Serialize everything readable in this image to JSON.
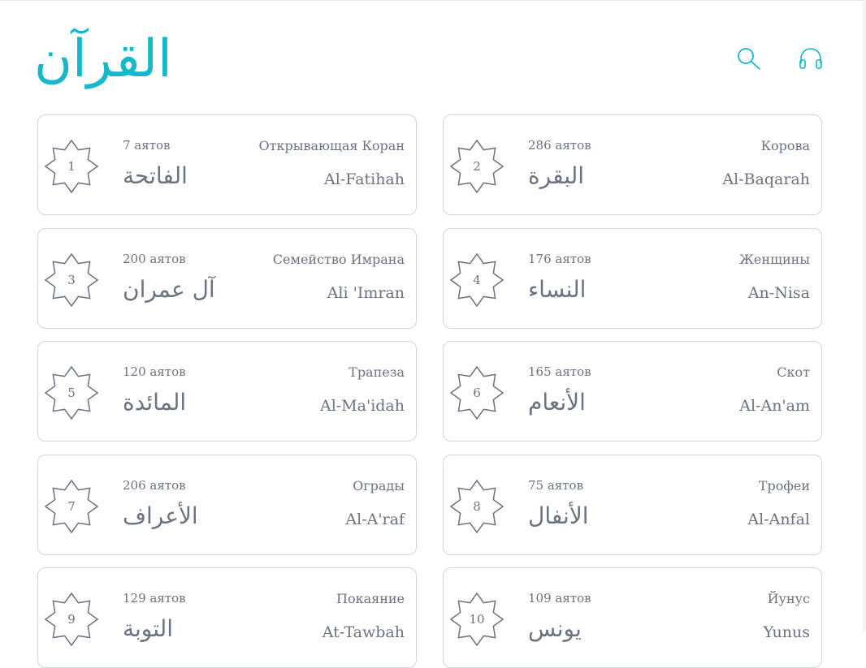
{
  "header": {
    "logo": "القرآن",
    "icons": [
      "search-icon",
      "headphones-icon"
    ],
    "accent_color": "#14b8c8"
  },
  "surahs": [
    {
      "number": "1",
      "ayahs": "7 аятов",
      "name_ru": "Открывающая Коран",
      "name_ar": "الفاتحة",
      "name_en": "Al-Fatihah"
    },
    {
      "number": "2",
      "ayahs": "286 аятов",
      "name_ru": "Корова",
      "name_ar": "البقرة",
      "name_en": "Al-Baqarah"
    },
    {
      "number": "3",
      "ayahs": "200 аятов",
      "name_ru": "Семейство Имрана",
      "name_ar": "آل عمران",
      "name_en": "Ali 'Imran"
    },
    {
      "number": "4",
      "ayahs": "176 аятов",
      "name_ru": "Женщины",
      "name_ar": "النساء",
      "name_en": "An-Nisa"
    },
    {
      "number": "5",
      "ayahs": "120 аятов",
      "name_ru": "Трапеза",
      "name_ar": "المائدة",
      "name_en": "Al-Ma'idah"
    },
    {
      "number": "6",
      "ayahs": "165 аятов",
      "name_ru": "Скот",
      "name_ar": "الأنعام",
      "name_en": "Al-An'am"
    },
    {
      "number": "7",
      "ayahs": "206 аятов",
      "name_ru": "Ограды",
      "name_ar": "الأعراف",
      "name_en": "Al-A'raf"
    },
    {
      "number": "8",
      "ayahs": "75 аятов",
      "name_ru": "Трофеи",
      "name_ar": "الأنفال",
      "name_en": "Al-Anfal"
    },
    {
      "number": "9",
      "ayahs": "129 аятов",
      "name_ru": "Покаяние",
      "name_ar": "التوبة",
      "name_en": "At-Tawbah"
    },
    {
      "number": "10",
      "ayahs": "109 аятов",
      "name_ru": "Йунус",
      "name_ar": "يونس",
      "name_en": "Yunus"
    }
  ]
}
